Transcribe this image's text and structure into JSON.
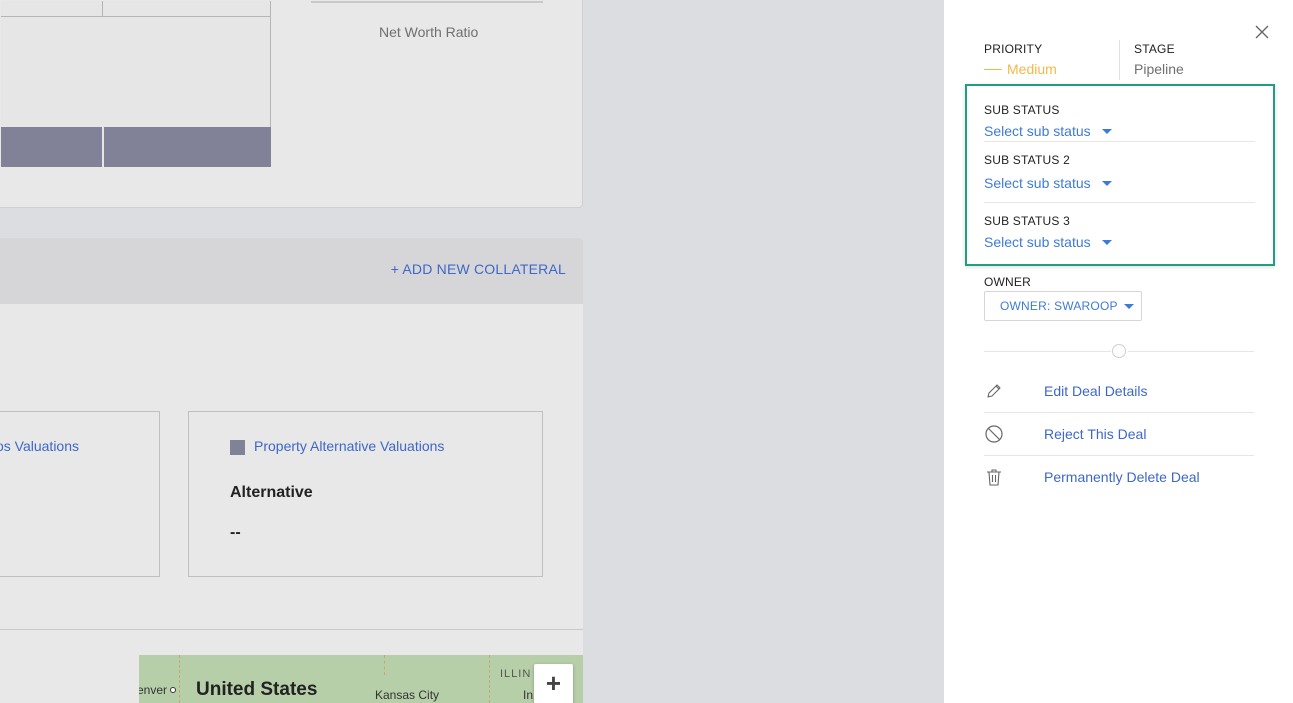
{
  "background": {
    "net_worth_label": "Net Worth Ratio",
    "add_collateral_label": "+ ADD NEW COLLATERAL",
    "left_card_label": "os Valuations",
    "right_card_label": "Property Alternative Valuations",
    "right_card_title": "Alternative",
    "right_card_value": "--",
    "map": {
      "city_left": "enver",
      "country": "United States",
      "city_mid": "Kansas City",
      "state": "ILLIN",
      "city_right": "In",
      "zoom_in": "+"
    }
  },
  "panel": {
    "close_icon": "close-icon",
    "priority": {
      "label": "PRIORITY",
      "value": "Medium",
      "color": "#f0b94a"
    },
    "stage": {
      "label": "STAGE",
      "value": "Pipeline"
    },
    "sub_statuses": [
      {
        "label": "SUB STATUS",
        "placeholder": "Select sub status"
      },
      {
        "label": "SUB STATUS 2",
        "placeholder": "Select sub status"
      },
      {
        "label": "SUB STATUS 3",
        "placeholder": "Select sub status"
      }
    ],
    "highlight_color": "#1f9e82",
    "owner": {
      "label": "OWNER",
      "button": "OWNER: SWAROOP"
    },
    "actions": [
      {
        "label": "Edit Deal Details",
        "icon": "pencil-icon"
      },
      {
        "label": "Reject This Deal",
        "icon": "block-icon"
      },
      {
        "label": "Permanently Delete Deal",
        "icon": "trash-icon"
      }
    ]
  }
}
